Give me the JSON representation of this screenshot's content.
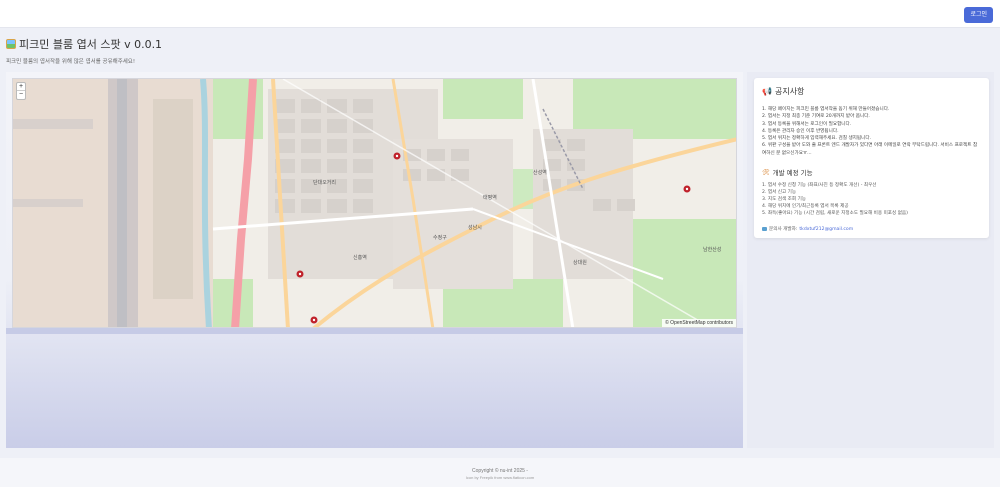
{
  "topbar": {
    "login_label": "로그인"
  },
  "header": {
    "title": "피크민 블룸 엽서 스팟 v 0.0.1",
    "subtitle": "피크민 블룸의 엽서작을 위해 많은 엽서를 공유해주세요!"
  },
  "map": {
    "zoom_in": "+",
    "zoom_out": "−",
    "attribution": "© OpenStreetMap contributors",
    "labels": [
      "성남시",
      "수정구",
      "산성역",
      "신흥역",
      "태평역",
      "상대원",
      "남한산성",
      "단대오거리"
    ]
  },
  "notice": {
    "title": "공지사항",
    "items": [
      "1. 해당 페이지는 피크민 블룸 엽서작을 돕기 위해 만들어졌습니다.",
      "2. 엽서는 지정 최종 기준 기여로 20개까지 받아 옵니다.",
      "3. 엽서 등록을 위해서는 로그인이 필요합니다.",
      "4. 등록은 관리자 승인 이후 반영됩니다.",
      "5. 엽서 위치는 정확하게 입력해주세요. 검칠 생지됩니다.",
      "6. 위판 구성을 받아 도와 줄 프론트 엔드 개발자가 있다면 아래 이메일로 연락 부탁드립니다. 서비스 프로젝트 참여하신 분 없으신가요ㅠ..."
    ],
    "plan_title": "개발 예정 기능",
    "plan_items": [
      "1. 엽서 수정 신청 기능 (좌표/사진 등 정확도 개선) - 최우선",
      "2. 엽서 신고 기능",
      "3. 지도 검색 조회 기능",
      "4. 해당 위치에 인기/최근등록 엽서 목록 제공",
      "5. 좌득(좋아요) 기능 (시간 검립, 새로운 지정소도 필요해 비용 미포싱 없음)"
    ],
    "contact_label": "문의사 개발자:",
    "contact_email": "tkdxtuf212@gmail.com"
  },
  "footer": {
    "copyright": "Copyright © nu-int 2025 -",
    "credit": "Icon by Freepik from www.flaticon.com"
  },
  "colors": {
    "accent": "#4a6ad8",
    "marker": "#c0222b",
    "park": "#c8e8b8",
    "road_major": "#f5a0a8",
    "road_secondary": "#fbd59a"
  }
}
